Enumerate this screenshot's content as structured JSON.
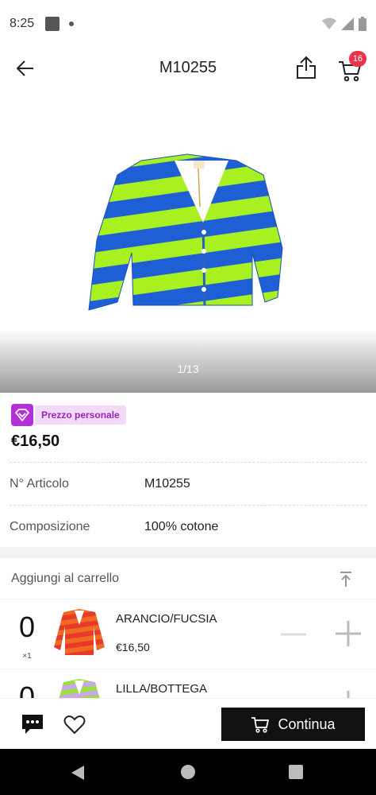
{
  "status": {
    "time": "8:25"
  },
  "header": {
    "title": "M10255",
    "cart_count": "16"
  },
  "gallery": {
    "counter": "1/13"
  },
  "pricing": {
    "badge_label": "Prezzo personale",
    "price": "€16,50"
  },
  "specs": [
    {
      "key": "N° Articolo",
      "value": "M10255"
    },
    {
      "key": "Composizione",
      "value": "100% cotone"
    }
  ],
  "cart": {
    "header_label": "Aggiungi al carrello",
    "variants": [
      {
        "name": "ARANCIO/FUCSIA",
        "price": "€16,50",
        "qty": "0",
        "unit": "×1"
      },
      {
        "name": "LILLA/BOTTEGA",
        "price": "",
        "qty": "0",
        "unit": ""
      }
    ]
  },
  "bottom": {
    "continue_label": "Continua"
  },
  "colors": {
    "accent": "#111111",
    "badge_bg": "#e8334a",
    "personal_price": "#b52fd8"
  }
}
